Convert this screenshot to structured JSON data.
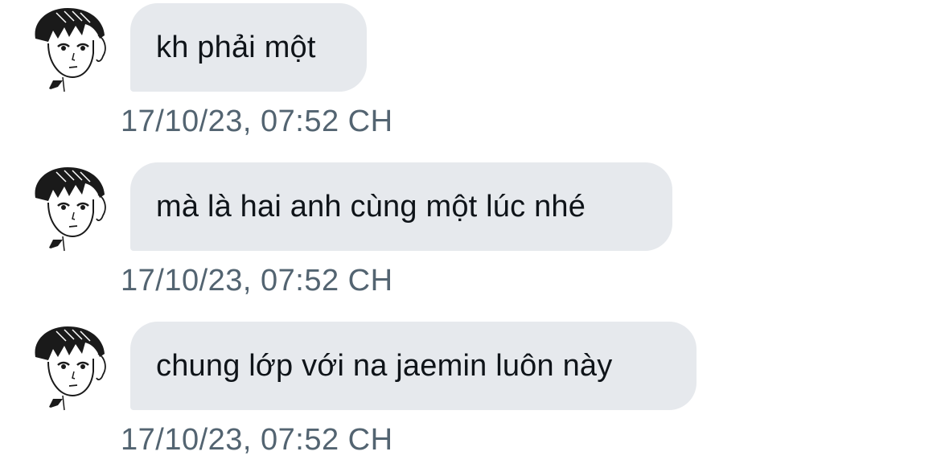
{
  "messages": [
    {
      "text": "kh phải một",
      "timestamp": "17/10/23, 07:52 CH",
      "avatar_icon": "manga-boy-avatar-icon"
    },
    {
      "text": "mà là hai anh cùng một lúc nhé",
      "timestamp": "17/10/23, 07:52 CH",
      "avatar_icon": "manga-boy-avatar-icon"
    },
    {
      "text": "chung lớp với na jaemin luôn này",
      "timestamp": "17/10/23, 07:52 CH",
      "avatar_icon": "manga-boy-avatar-icon"
    }
  ],
  "colors": {
    "bubble_bg": "#e6e9ed",
    "text": "#0f1419",
    "timestamp": "#536471"
  }
}
